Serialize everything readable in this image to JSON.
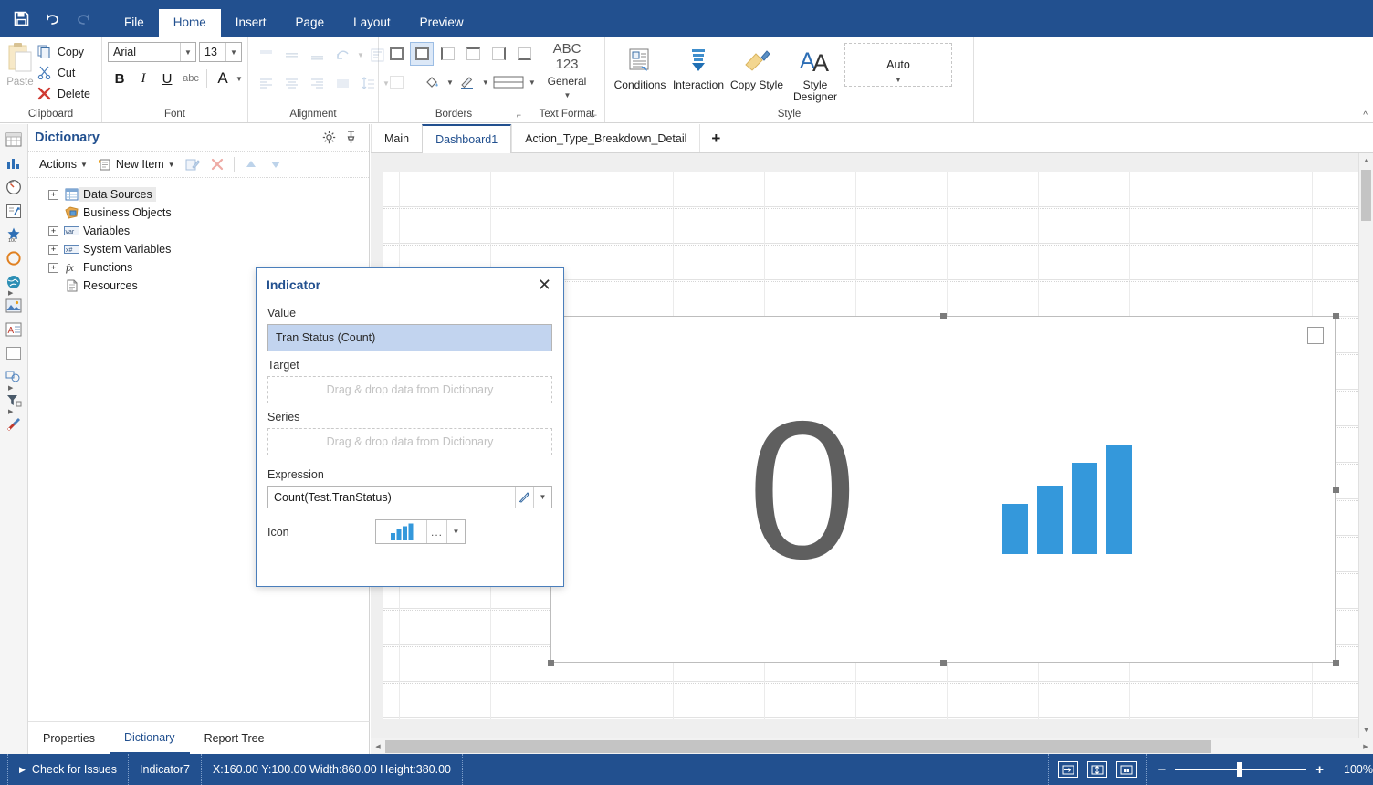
{
  "app": {
    "quick_access": [
      {
        "name": "save",
        "label": "Save"
      },
      {
        "name": "undo",
        "label": "Undo"
      },
      {
        "name": "redo",
        "label": "Redo"
      }
    ],
    "menu_tabs": [
      {
        "label": "File",
        "active": false
      },
      {
        "label": "Home",
        "active": true
      },
      {
        "label": "Insert",
        "active": false
      },
      {
        "label": "Page",
        "active": false
      },
      {
        "label": "Layout",
        "active": false
      },
      {
        "label": "Preview",
        "active": false
      }
    ]
  },
  "ribbon": {
    "clipboard": {
      "group_label": "Clipboard",
      "paste_label": "Paste",
      "commands": [
        {
          "label": "Copy",
          "icon": "copy-icon"
        },
        {
          "label": "Cut",
          "icon": "cut-icon"
        },
        {
          "label": "Delete",
          "icon": "delete-icon"
        }
      ]
    },
    "font": {
      "group_label": "Font",
      "family_value": "Arial",
      "size_value": "13",
      "bold_label": "B",
      "italic_label": "I",
      "underline_label": "U",
      "strike_label": "abc",
      "color_label": "A"
    },
    "alignment": {
      "group_label": "Alignment"
    },
    "borders": {
      "group_label": "Borders"
    },
    "text_format": {
      "group_label": "Text Format",
      "sample_line1": "ABC",
      "sample_line2": "123",
      "format_value": "General"
    },
    "style": {
      "group_label": "Style",
      "buttons": [
        {
          "label": "Conditions",
          "icon": "conditions-icon"
        },
        {
          "label": "Interaction",
          "icon": "interaction-icon"
        },
        {
          "label": "Copy Style",
          "icon": "copy-style-icon"
        },
        {
          "label": "Style Designer",
          "icon": "style-designer-icon"
        }
      ],
      "auto_value": "Auto"
    }
  },
  "left_toolbar": [
    {
      "name": "table-tool"
    },
    {
      "name": "chart-tool"
    },
    {
      "name": "gauge-tool"
    },
    {
      "name": "indicator-tool"
    },
    {
      "name": "progress-tool"
    },
    {
      "name": "shape-tool"
    },
    {
      "name": "map-tool"
    },
    {
      "name": "image-tool"
    },
    {
      "name": "text-tool"
    },
    {
      "name": "panel-tool"
    },
    {
      "name": "region-map-tool"
    },
    {
      "name": "filter-tool"
    },
    {
      "name": "tools-tool"
    }
  ],
  "dictionary": {
    "title": "Dictionary",
    "toolbar": {
      "actions_label": "Actions",
      "new_item_label": "New Item"
    },
    "tree": [
      {
        "label": "Data Sources",
        "icon": "data-sources-icon",
        "expandable": true,
        "selected": true
      },
      {
        "label": "Business Objects",
        "icon": "business-objects-icon",
        "expandable": false,
        "selected": false
      },
      {
        "label": "Variables",
        "icon": "variables-icon",
        "expandable": true,
        "selected": false
      },
      {
        "label": "System Variables",
        "icon": "system-variables-icon",
        "expandable": true,
        "selected": false
      },
      {
        "label": "Functions",
        "icon": "functions-icon",
        "expandable": true,
        "selected": false
      },
      {
        "label": "Resources",
        "icon": "resources-icon",
        "expandable": false,
        "selected": false
      }
    ],
    "panel_tabs": [
      {
        "label": "Properties",
        "active": false
      },
      {
        "label": "Dictionary",
        "active": true
      },
      {
        "label": "Report Tree",
        "active": false
      }
    ]
  },
  "document": {
    "tabs": [
      {
        "label": "Main",
        "active": false
      },
      {
        "label": "Dashboard1",
        "active": true
      },
      {
        "label": "Action_Type_Breakdown_Detail",
        "active": false
      }
    ],
    "add_tab_label": "+"
  },
  "indicator_preview": {
    "value_text": "0",
    "bars": [
      55,
      75,
      100,
      120
    ],
    "bar_color": "#3498db",
    "value_color": "#5f5f5f"
  },
  "dialog": {
    "title": "Indicator",
    "close_label": "✕",
    "value_label": "Value",
    "value_field": "Tran Status (Count)",
    "target_label": "Target",
    "target_placeholder": "Drag & drop data from Dictionary",
    "series_label": "Series",
    "series_placeholder": "Drag & drop data from Dictionary",
    "expression_label": "Expression",
    "expression_value": "Count(Test.TranStatus)",
    "icon_label": "Icon",
    "icon_ellipsis": "...",
    "accent_color": "#22508f",
    "selection_color": "#c2d4ef"
  },
  "statusbar": {
    "check_issues_label": "Check for Issues",
    "object_name": "Indicator7",
    "geometry": "X:160.00 Y:100.00 Width:860.00 Height:380.00",
    "zoom_minus": "−",
    "zoom_plus": "+",
    "zoom_level": "100%"
  }
}
